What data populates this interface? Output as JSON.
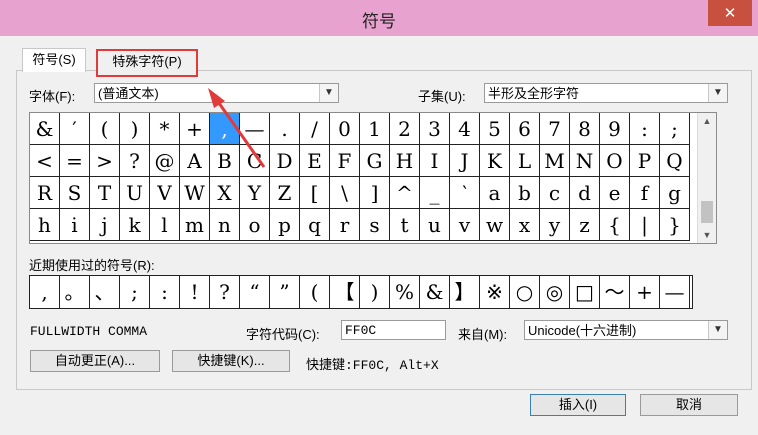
{
  "window": {
    "title": "符号",
    "close_glyph": "✕"
  },
  "tabs": [
    {
      "label": "符号(S)"
    },
    {
      "label": "特殊字符(P)"
    }
  ],
  "font": {
    "label": "字体(F):",
    "value": "(普通文本)"
  },
  "subset": {
    "label": "子集(U):",
    "value": "半形及全形字符"
  },
  "symbol_grid": {
    "rows": [
      [
        "&",
        "′",
        "(",
        ")",
        "*",
        "+",
        ",",
        "—",
        ".",
        "/",
        "0",
        "1",
        "2",
        "3",
        "4",
        "5",
        "6",
        "7",
        "8",
        "9",
        ":",
        ";"
      ],
      [
        "<",
        "=",
        ">",
        "?",
        "@",
        "A",
        "B",
        "C",
        "D",
        "E",
        "F",
        "G",
        "H",
        "I",
        "J",
        "K",
        "L",
        "M",
        "N",
        "O",
        "P",
        "Q"
      ],
      [
        "R",
        "S",
        "T",
        "U",
        "V",
        "W",
        "X",
        "Y",
        "Z",
        "[",
        "\\",
        "]",
        "^",
        "_",
        "‵",
        "a",
        "b",
        "c",
        "d",
        "e",
        "f",
        "g"
      ],
      [
        "h",
        "i",
        "j",
        "k",
        "l",
        "m",
        "n",
        "o",
        "p",
        "q",
        "r",
        "s",
        "t",
        "u",
        "v",
        "w",
        "x",
        "y",
        "z",
        "{",
        "|",
        "}"
      ]
    ],
    "selected": {
      "row": 0,
      "col": 6
    }
  },
  "recent": {
    "label": "近期使用过的符号(R):",
    "symbols": [
      ",",
      "。",
      "、",
      ";",
      ":",
      "!",
      "?",
      "“",
      "”",
      "(",
      "【",
      ")",
      "%",
      "&",
      "】",
      "※",
      "○",
      "◎",
      "□",
      "～",
      "+",
      "—"
    ]
  },
  "char_name": "FULLWIDTH COMMA",
  "char_code": {
    "label": "字符代码(C):",
    "value": "FF0C"
  },
  "from": {
    "label": "来自(M):",
    "value": "Unicode(十六进制)"
  },
  "buttons": {
    "autocorrect": "自动更正(A)...",
    "shortcut_key": "快捷键(K)...",
    "insert": "插入(I)",
    "cancel": "取消"
  },
  "shortcut_text": "快捷键:FF0C, Alt+X",
  "colors": {
    "titlebar": "#e8a2cf",
    "close": "#c7503f",
    "selection": "#3399ff",
    "highlight": "#e03a3a"
  }
}
